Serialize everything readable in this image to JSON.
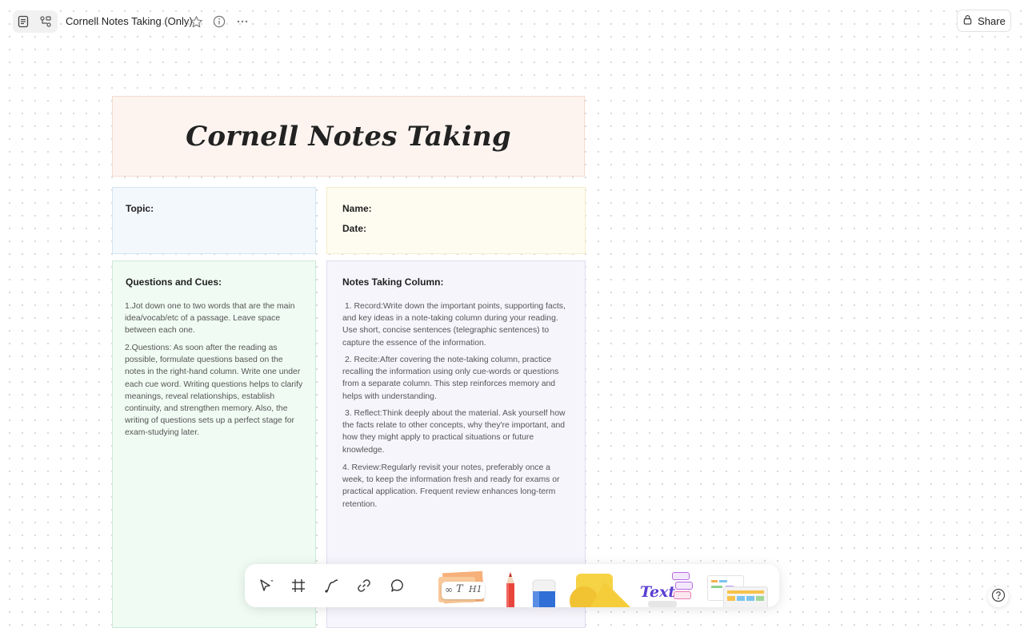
{
  "header": {
    "title": "Cornell Notes Taking (Only)",
    "share_label": "Share",
    "icons": [
      "document-icon",
      "flow-icon",
      "star-icon",
      "info-icon",
      "more-icon",
      "lock-icon"
    ]
  },
  "board": {
    "title": "Cornell Notes Taking",
    "topic_label": "Topic:",
    "name_label": "Name:",
    "date_label": "Date:",
    "questions": {
      "heading": "Questions and Cues:",
      "items": [
        "1.Jot down one to two words that are the main idea/vocab/etc of a passage. Leave space between each one.",
        "2.Questions: As soon after the reading as possible, formulate questions based on the notes in the right-hand column. Write one under each cue word. Writing questions helps to clarify meanings, reveal relationships, establish continuity, and strengthen memory. Also, the writing of questions sets up a perfect stage for exam-studying later."
      ]
    },
    "notes": {
      "heading": "Notes Taking Column:",
      "items": [
        "1. Record:Write down the important points, supporting facts, and key ideas in a note-taking column during your reading. Use short, concise sentences (telegraphic sentences) to capture the essence of the information.",
        "2. Recite:After covering the note-taking column, practice recalling the information using only cue-words or questions from a separate column. This step reinforces memory and helps with understanding.",
        "3. Reflect:Think deeply about the material. Ask yourself how the facts relate to other concepts, why they're important, and how they might apply to practical situations or future knowledge.",
        "4. Review:Regularly revisit your notes, preferably once a week, to keep the information fresh and ready for exams or practical application. Frequent review enhances long-term retention."
      ]
    }
  },
  "toolbar": {
    "tools": [
      "select-tool",
      "frame-tool",
      "connector-tool",
      "link-tool",
      "comment-tool"
    ],
    "stickers": {
      "h1_label": "H1",
      "text_label": "Text"
    }
  },
  "help_icon": "help-icon",
  "colors": {
    "title_bg": "#fdf4f0",
    "topic_bg": "#f3f8fd",
    "name_bg": "#fefcf1",
    "questions_bg": "#f0fbf4",
    "notes_bg": "#f7f5fc"
  }
}
